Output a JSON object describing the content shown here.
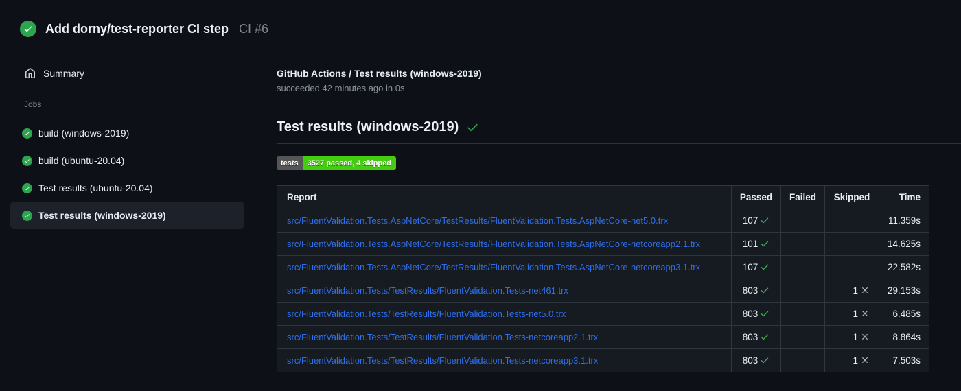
{
  "header": {
    "title": "Add dorny/test-reporter CI step",
    "run_number": "CI #6"
  },
  "sidebar": {
    "summary_label": "Summary",
    "jobs_label": "Jobs",
    "jobs": [
      {
        "label": "build (windows-2019)",
        "selected": false
      },
      {
        "label": "build (ubuntu-20.04)",
        "selected": false
      },
      {
        "label": "Test results (ubuntu-20.04)",
        "selected": false
      },
      {
        "label": "Test results (windows-2019)",
        "selected": true
      }
    ]
  },
  "main": {
    "check_title": "GitHub Actions / Test results (windows-2019)",
    "check_status": "succeeded 42 minutes ago in 0s",
    "heading": "Test results (windows-2019)",
    "badge": {
      "label": "tests",
      "value": "3527 passed, 4 skipped"
    },
    "table": {
      "headers": [
        "Report",
        "Passed",
        "Failed",
        "Skipped",
        "Time"
      ],
      "rows": [
        {
          "report": "src/FluentValidation.Tests.AspNetCore/TestResults/FluentValidation.Tests.AspNetCore-net5.0.trx",
          "passed": "107",
          "failed": "",
          "skipped": "",
          "time": "11.359s"
        },
        {
          "report": "src/FluentValidation.Tests.AspNetCore/TestResults/FluentValidation.Tests.AspNetCore-netcoreapp2.1.trx",
          "passed": "101",
          "failed": "",
          "skipped": "",
          "time": "14.625s"
        },
        {
          "report": "src/FluentValidation.Tests.AspNetCore/TestResults/FluentValidation.Tests.AspNetCore-netcoreapp3.1.trx",
          "passed": "107",
          "failed": "",
          "skipped": "",
          "time": "22.582s"
        },
        {
          "report": "src/FluentValidation.Tests/TestResults/FluentValidation.Tests-net461.trx",
          "passed": "803",
          "failed": "",
          "skipped": "1",
          "time": "29.153s"
        },
        {
          "report": "src/FluentValidation.Tests/TestResults/FluentValidation.Tests-net5.0.trx",
          "passed": "803",
          "failed": "",
          "skipped": "1",
          "time": "6.485s"
        },
        {
          "report": "src/FluentValidation.Tests/TestResults/FluentValidation.Tests-netcoreapp2.1.trx",
          "passed": "803",
          "failed": "",
          "skipped": "1",
          "time": "8.864s"
        },
        {
          "report": "src/FluentValidation.Tests/TestResults/FluentValidation.Tests-netcoreapp3.1.trx",
          "passed": "803",
          "failed": "",
          "skipped": "1",
          "time": "7.503s"
        }
      ]
    }
  },
  "colors": {
    "page_bg": "#0d1117",
    "cell_bg": "#161b22",
    "table_border": "#30363d",
    "success_circle_green": "#2da44e",
    "check_green": "#3fb950",
    "link_blue": "#2f6feb",
    "badge_label_bg": "#555555",
    "badge_value_bg": "#44cc11",
    "muted_text": "#8b949e"
  }
}
